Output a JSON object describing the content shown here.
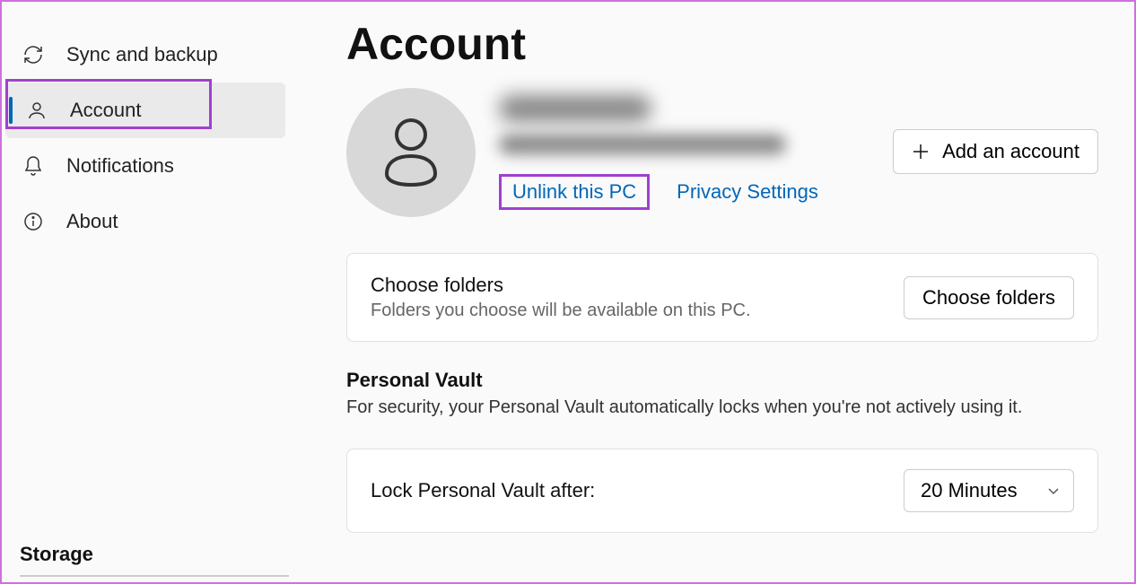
{
  "sidebar": {
    "items": [
      {
        "label": "Sync and backup"
      },
      {
        "label": "Account"
      },
      {
        "label": "Notifications"
      },
      {
        "label": "About"
      }
    ],
    "storage_label": "Storage"
  },
  "page": {
    "title": "Account",
    "unlink_label": "Unlink this PC",
    "privacy_label": "Privacy Settings",
    "add_account_label": "Add an account"
  },
  "choose_folders": {
    "title": "Choose folders",
    "desc": "Folders you choose will be available on this PC.",
    "button": "Choose folders"
  },
  "vault": {
    "title": "Personal Vault",
    "desc": "For security, your Personal Vault automatically locks when you're not actively using it.",
    "lock_label": "Lock Personal Vault after:",
    "lock_value": "20 Minutes"
  }
}
